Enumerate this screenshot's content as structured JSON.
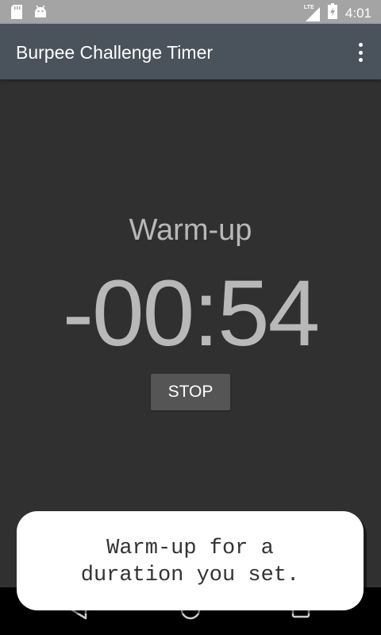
{
  "status_bar": {
    "time": "4:01",
    "network_label": "LTE",
    "icons": [
      "sd-card-icon",
      "android-icon",
      "signal-icon",
      "battery-icon"
    ]
  },
  "app_bar": {
    "title": "Burpee Challenge Timer"
  },
  "timer": {
    "phase": "Warm-up",
    "display": "-00:54",
    "stop_label": "STOP"
  },
  "tooltip": {
    "text": "Warm-up for a\nduration you set."
  },
  "nav_bar": {
    "icons": [
      "back-icon",
      "home-icon",
      "recents-icon"
    ]
  },
  "colors": {
    "status_bar": "#a4a4a4",
    "app_bar": "#4a525c",
    "background": "#303030",
    "timer_text": "#b8b8b8",
    "button": "#555555",
    "tooltip_bg": "#ffffff"
  }
}
